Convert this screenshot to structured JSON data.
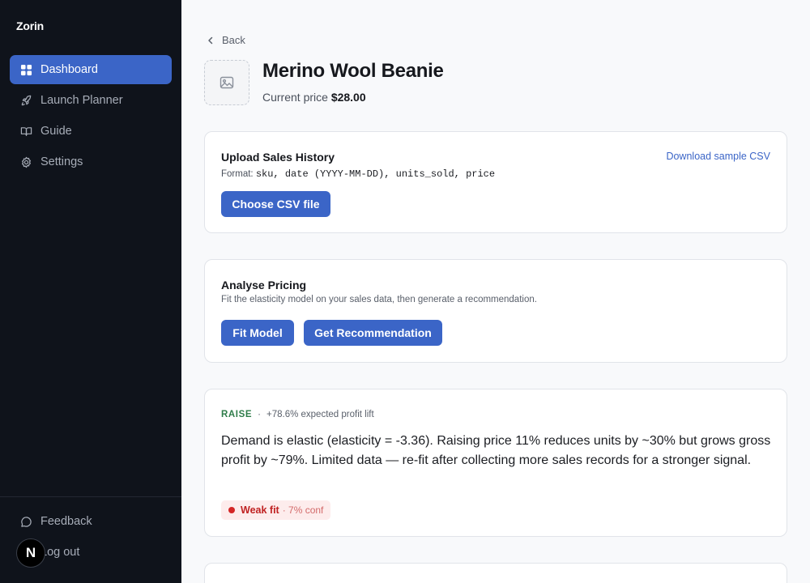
{
  "app": {
    "name": "Zorin"
  },
  "sidebar": {
    "items": [
      {
        "label": "Dashboard",
        "icon": "dashboard-icon",
        "active": true
      },
      {
        "label": "Launch Planner",
        "icon": "rocket-icon"
      },
      {
        "label": "Guide",
        "icon": "book-icon"
      },
      {
        "label": "Settings",
        "icon": "gear-icon"
      }
    ],
    "bottom": [
      {
        "label": "Feedback",
        "icon": "chat-icon"
      },
      {
        "label": "Log out",
        "icon": "logout-icon"
      }
    ],
    "avatar_letter": "N"
  },
  "header": {
    "back_label": "Back",
    "product_title": "Merino Wool Beanie",
    "price_label": "Current price",
    "price_value": "$28.00"
  },
  "upload": {
    "title": "Upload Sales History",
    "download_link": "Download sample CSV",
    "format_label": "Format:",
    "format_columns": "sku, date (YYYY-MM-DD), units_sold, price",
    "choose_button": "Choose CSV file"
  },
  "analyse": {
    "title": "Analyse Pricing",
    "description": "Fit the elasticity model on your sales data, then generate a recommendation.",
    "fit_button": "Fit Model",
    "recommend_button": "Get Recommendation"
  },
  "recommendation": {
    "action": "RAISE",
    "separator": "·",
    "lift": "+78.6% expected profit lift",
    "body": "Demand is elastic (elasticity = -3.36). Raising price 11% reduces units by ~30% but grows gross profit by ~79%. Limited data — re-fit after collecting more sales records for a stronger signal.",
    "fit_label": "Weak fit",
    "confidence": "· 7% conf"
  },
  "colors": {
    "accent": "#3b65c7",
    "sidebar_bg": "#0f131b",
    "raise": "#2f7d4a",
    "weak_fit": "#c02222"
  }
}
